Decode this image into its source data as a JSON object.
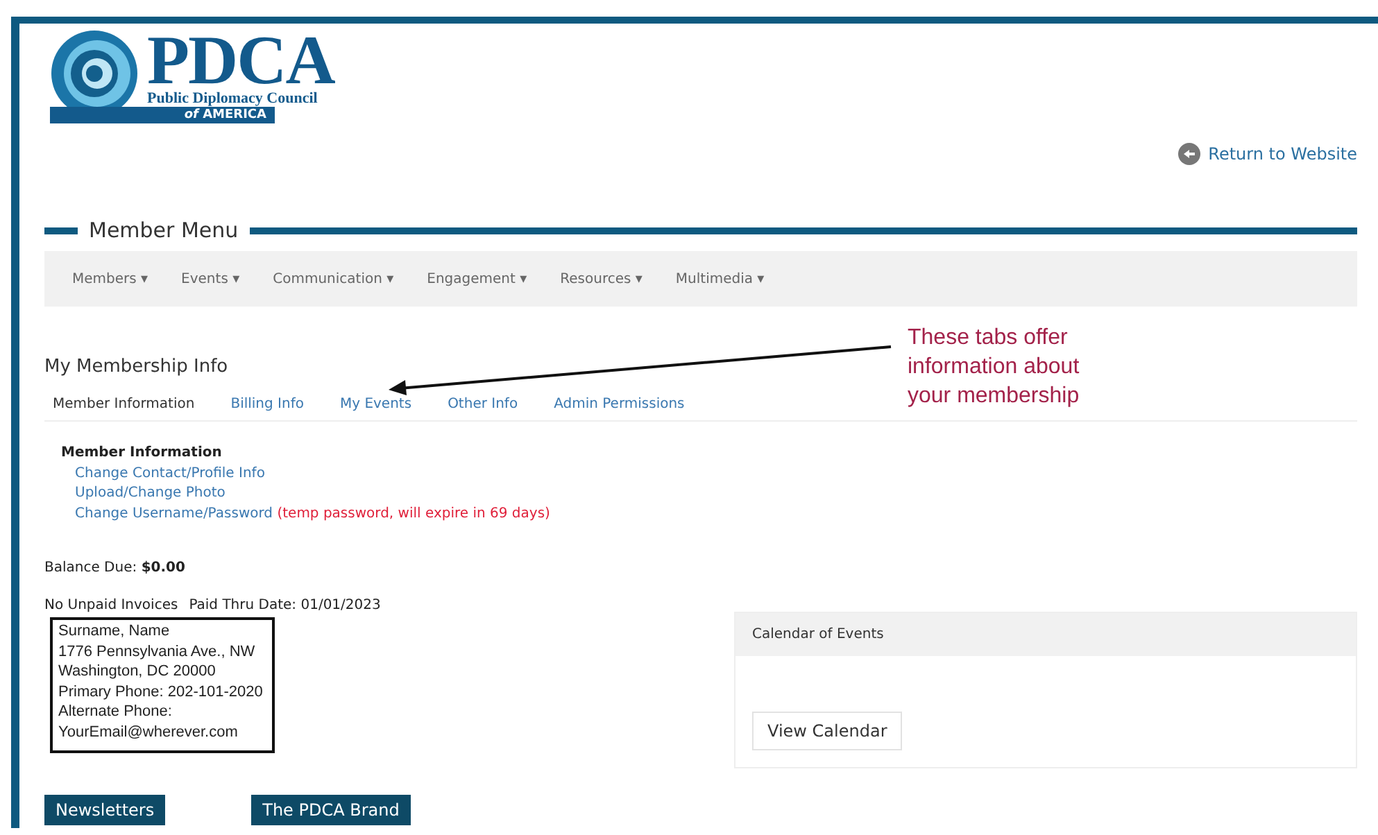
{
  "logo": {
    "name": "PDCA",
    "subtitle": "Public Diplomacy Council",
    "tagline_prefix": "of",
    "tagline": "AMERICA"
  },
  "return_link": "Return to Website",
  "member_menu": {
    "title": "Member Menu",
    "items": [
      {
        "label": "Members",
        "caret": "▾"
      },
      {
        "label": "Events",
        "caret": "▾"
      },
      {
        "label": "Communication",
        "caret": "▾"
      },
      {
        "label": "Engagement",
        "caret": "▾"
      },
      {
        "label": "Resources",
        "caret": "▾"
      },
      {
        "label": "Multimedia",
        "caret": "▾"
      }
    ]
  },
  "annotation": "These tabs offer information about your membership",
  "membership": {
    "title": "My Membership Info",
    "tabs": [
      {
        "label": "Member Information",
        "selected": true
      },
      {
        "label": "Billing Info",
        "selected": false
      },
      {
        "label": "My Events",
        "selected": false
      },
      {
        "label": "Other Info",
        "selected": false
      },
      {
        "label": "Admin Permissions",
        "selected": false
      }
    ],
    "section_title": "Member Information",
    "links": [
      {
        "label": "Change Contact/Profile Info"
      },
      {
        "label": "Upload/Change Photo"
      },
      {
        "label": "Change Username/Password",
        "note": "(temp password, will expire in 69 days)"
      }
    ],
    "balance_label": "Balance Due:",
    "balance": "$0.00",
    "invoices": "No Unpaid Invoices",
    "paid_thru": "Paid Thru Date: 01/01/2023",
    "address": [
      "Surname, Name",
      "1776 Pennsylvania Ave., NW",
      "Washington, DC 20000",
      "Primary Phone: 202-101-2020",
      "Alternate Phone:",
      "YourEmail@wherever.com"
    ]
  },
  "calendar": {
    "title": "Calendar of Events",
    "button": "View Calendar"
  },
  "bottom_buttons": [
    "Newsletters",
    "The PDCA Brand"
  ]
}
